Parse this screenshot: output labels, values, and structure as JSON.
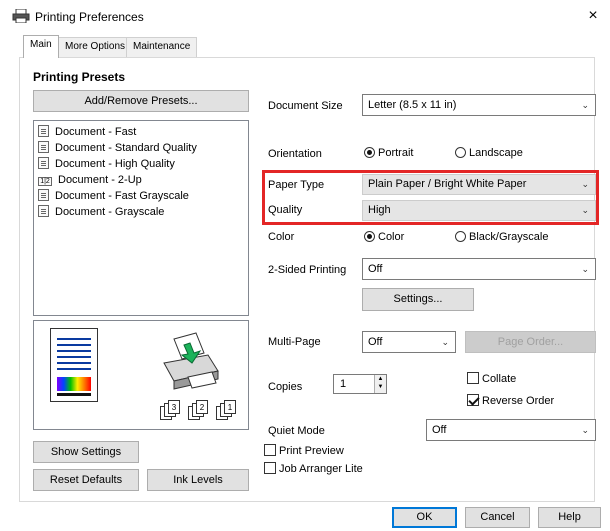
{
  "window": {
    "title": "Printing Preferences",
    "close_glyph": "×"
  },
  "tabs": [
    {
      "label": "Main",
      "active": true
    },
    {
      "label": "More Options",
      "active": false
    },
    {
      "label": "Maintenance",
      "active": false
    }
  ],
  "presets": {
    "heading": "Printing Presets",
    "add_remove_label": "Add/Remove Presets...",
    "items": [
      {
        "label": "Document - Fast",
        "icon": "document-preset-icon"
      },
      {
        "label": "Document - Standard Quality",
        "icon": "document-preset-icon"
      },
      {
        "label": "Document - High Quality",
        "icon": "document-preset-icon"
      },
      {
        "label": "Document - 2-Up",
        "icon": "two-up-preset-icon",
        "icon_text": "1|2"
      },
      {
        "label": "Document - Fast Grayscale",
        "icon": "document-preset-icon"
      },
      {
        "label": "Document - Grayscale",
        "icon": "document-preset-icon"
      }
    ]
  },
  "preview": {
    "icon": "printer-preview-icon",
    "collate_numbers": [
      "3",
      "2",
      "1"
    ]
  },
  "left_buttons": {
    "show_settings": "Show Settings",
    "reset_defaults": "Reset Defaults",
    "ink_levels": "Ink Levels"
  },
  "document_size": {
    "label": "Document Size",
    "value": "Letter (8.5 x 11 in)"
  },
  "orientation": {
    "label": "Orientation",
    "options": [
      {
        "label": "Portrait",
        "selected": true
      },
      {
        "label": "Landscape",
        "selected": false
      }
    ]
  },
  "paper_type": {
    "label": "Paper Type",
    "value": "Plain Paper / Bright White Paper"
  },
  "quality": {
    "label": "Quality",
    "value": "High"
  },
  "color": {
    "label": "Color",
    "options": [
      {
        "label": "Color",
        "selected": true
      },
      {
        "label": "Black/Grayscale",
        "selected": false
      }
    ]
  },
  "two_sided": {
    "label": "2-Sided Printing",
    "value": "Off",
    "settings_label": "Settings..."
  },
  "multi_page": {
    "label": "Multi-Page",
    "value": "Off",
    "page_order_label": "Page Order..."
  },
  "copies": {
    "label": "Copies",
    "value": "1",
    "collate": {
      "label": "Collate",
      "checked": false
    },
    "reverse_order": {
      "label": "Reverse Order",
      "checked": true
    }
  },
  "quiet_mode": {
    "label": "Quiet Mode",
    "value": "Off"
  },
  "print_preview": {
    "label": "Print Preview",
    "checked": false
  },
  "job_arranger": {
    "label": "Job Arranger Lite",
    "checked": false
  },
  "footer": {
    "ok": "OK",
    "cancel": "Cancel",
    "help": "Help"
  },
  "colors": {
    "highlight_box": "#e32626",
    "button_face": "#e1e1e1",
    "focus_border": "#0078d7"
  }
}
